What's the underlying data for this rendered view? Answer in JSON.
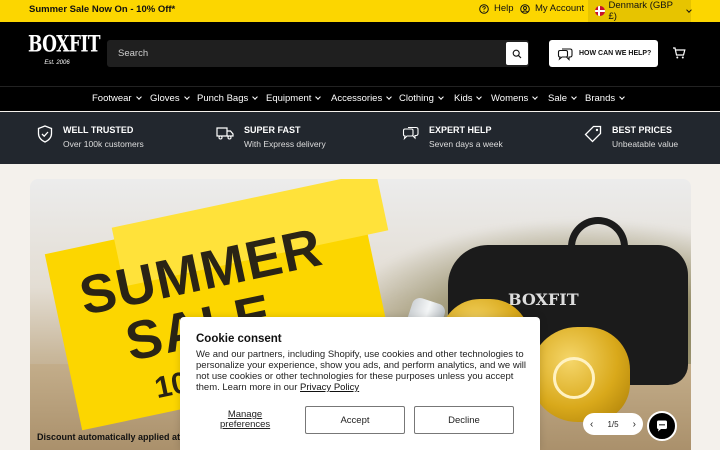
{
  "announcement": {
    "promo": "Summer Sale Now On - 10% Off*",
    "help": "Help",
    "account": "My Account",
    "region": "Denmark (GBP £)"
  },
  "header": {
    "logo_text": "BOXFIT",
    "logo_tagline": "Est. 2006",
    "search_placeholder": "Search",
    "help_button": "HOW CAN WE HELP?"
  },
  "nav": {
    "items": [
      {
        "label": "Footwear"
      },
      {
        "label": "Gloves"
      },
      {
        "label": "Punch Bags"
      },
      {
        "label": "Equipment"
      },
      {
        "label": "Accessories"
      },
      {
        "label": "Clothing"
      },
      {
        "label": "Kids"
      },
      {
        "label": "Womens"
      },
      {
        "label": "Sale"
      },
      {
        "label": "Brands"
      }
    ]
  },
  "usp": [
    {
      "title": "WELL TRUSTED",
      "subtitle": "Over 100k customers",
      "icon": "shield-check-icon"
    },
    {
      "title": "SUPER FAST",
      "subtitle": "With Express delivery",
      "icon": "truck-icon"
    },
    {
      "title": "EXPERT HELP",
      "subtitle": "Seven days a week",
      "icon": "chat-bubbles-icon"
    },
    {
      "title": "BEST PRICES",
      "subtitle": "Unbeatable value",
      "icon": "price-tag-icon"
    }
  ],
  "hero": {
    "headline_line1": "SUMMER",
    "headline_line2": "SALE",
    "headline_line3": "10",
    "bag_logo": "BOXFIT",
    "caption": "Discount automatically applied at che",
    "pager": "1/5"
  },
  "cookie": {
    "title": "Cookie consent",
    "body": "We and our partners, including Shopify, use cookies and other technologies to personalize your experience, show you ads, and perform analytics, and we will not use cookies or other technologies for these purposes unless you accept them. Learn more in our ",
    "policy_link": "Privacy Policy",
    "manage": "Manage preferences",
    "accept": "Accept",
    "decline": "Decline"
  },
  "colors": {
    "accent": "#fcd600",
    "header_bg": "#000000",
    "usp_bg": "#22272e"
  }
}
